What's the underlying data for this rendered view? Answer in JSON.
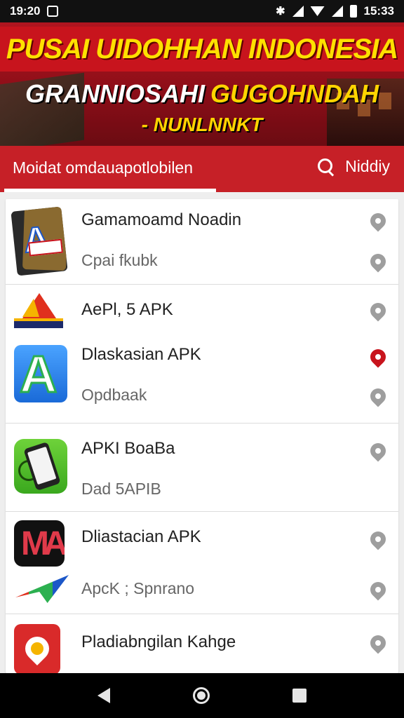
{
  "status_bar": {
    "time": "19:20",
    "clock_right": "15:33",
    "icons": [
      "notification-icon",
      "bluetooth-icon",
      "signal-icon",
      "wifi-icon",
      "battery-icon"
    ]
  },
  "banner": {
    "line1": "PUSAI UIDOHHAN INDONESIA",
    "line2_white": "GRANNIOSAHI",
    "line2_yellow": "GUGOHNDAH",
    "line3": "- NUNLNNKT"
  },
  "tabs": {
    "active_label": "Moidat omdauapotlobilen",
    "search_label": "Niddiy"
  },
  "list": [
    {
      "icon": "card-app-icon",
      "title": "Gamamoamd Noadin",
      "sub": "Cpai fkubk"
    },
    {
      "icon": "triangle-app-icon",
      "title": "AePl, 5 APK",
      "sub": ""
    },
    {
      "icon": "blue-a-app-icon",
      "title": "Dlaskasian APK",
      "sub": "Opdbaak"
    },
    {
      "icon": "phone-app-icon",
      "title": "APKI BoaBa",
      "sub": "Dad 5APIB"
    },
    {
      "icon": "ma-app-icon",
      "title": "Dliastacian APK",
      "sub": "ApcK ; Spnrano"
    },
    {
      "icon": "map-pin-app-icon",
      "title": "Pladiabngilan Kahge",
      "sub": ""
    }
  ],
  "nav": {
    "back": "back-icon",
    "home": "home-icon",
    "recent": "recent-apps-icon"
  },
  "colors": {
    "accent": "#c62027",
    "banner_yellow": "#ffd400",
    "pin_gray": "#9e9e9e",
    "pin_red": "#c8141d"
  }
}
